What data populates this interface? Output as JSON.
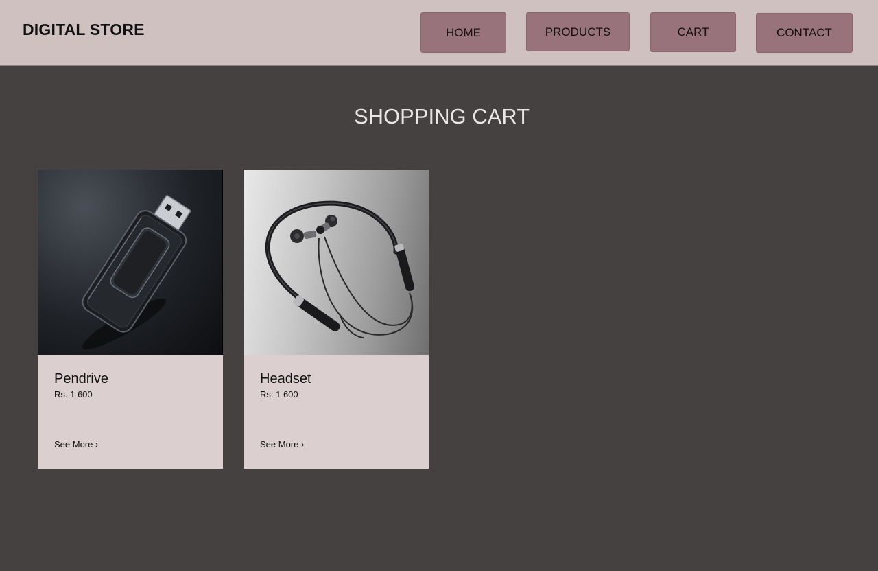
{
  "brand": {
    "title": "DIGITAL STORE"
  },
  "nav": {
    "home": "HOME",
    "products": "PRODUCTS",
    "cart": "CART",
    "contact": "CONTACT"
  },
  "page": {
    "title": "SHOPPING CART"
  },
  "cart": {
    "items": [
      {
        "name": "Pendrive",
        "price": "Rs. 1 600",
        "link": "See More ›",
        "image_icon": "usb-pendrive-image"
      },
      {
        "name": "Headset",
        "price": "Rs. 1 600",
        "link": "See More ›",
        "image_icon": "neckband-headset-image"
      }
    ]
  },
  "colors": {
    "background": "#454140",
    "header": "#d0c1c1",
    "nav_button": "#99737b",
    "card": "#dbcfd0",
    "title_text": "#ebe6e6"
  }
}
